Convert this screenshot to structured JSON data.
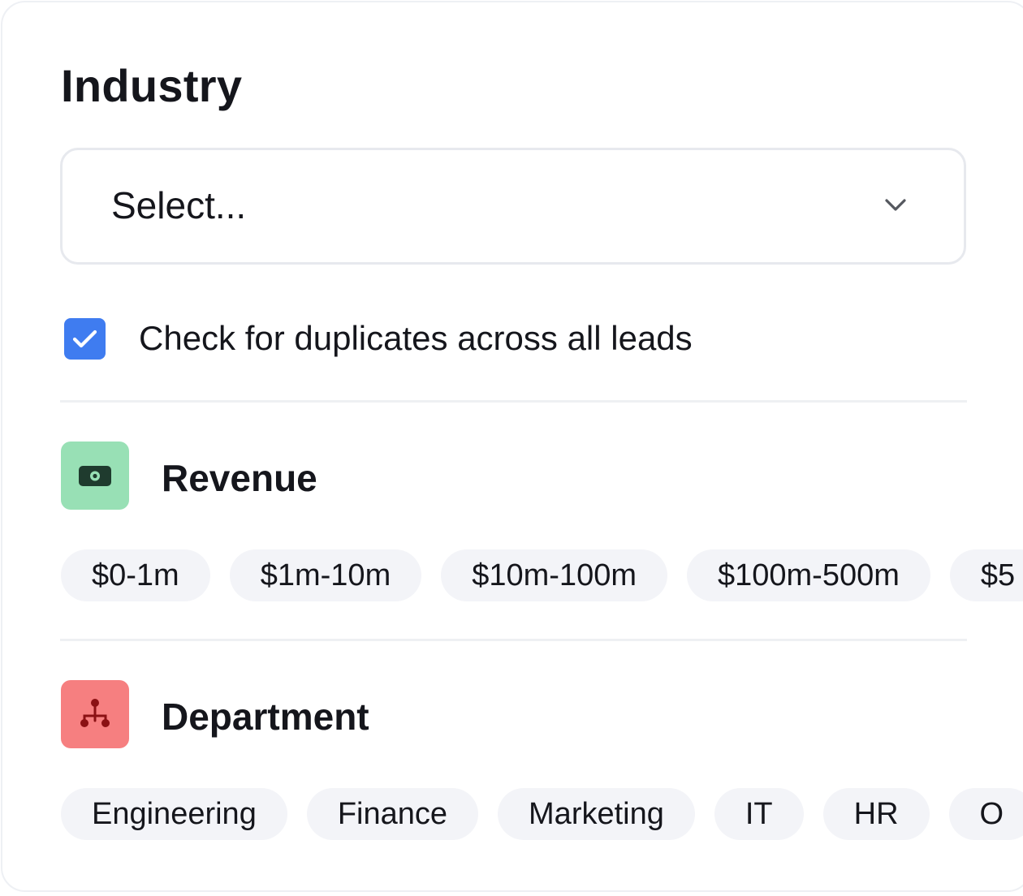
{
  "industry": {
    "label": "Industry",
    "select_placeholder": "Select..."
  },
  "duplicates": {
    "checked": true,
    "label": "Check for duplicates across all leads"
  },
  "revenue": {
    "title": "Revenue",
    "icon": "cash-icon",
    "icon_bg": "#98e0b5",
    "options": [
      "$0-1m",
      "$1m-10m",
      "$10m-100m",
      "$100m-500m",
      "$5"
    ]
  },
  "department": {
    "title": "Department",
    "icon": "org-chart-icon",
    "icon_bg": "#f67f80",
    "options": [
      "Engineering",
      "Finance",
      "Marketing",
      "IT",
      "HR",
      "O"
    ]
  },
  "colors": {
    "checkbox": "#3f7cf0",
    "chip_bg": "#f3f4f8",
    "text": "#15161c"
  }
}
